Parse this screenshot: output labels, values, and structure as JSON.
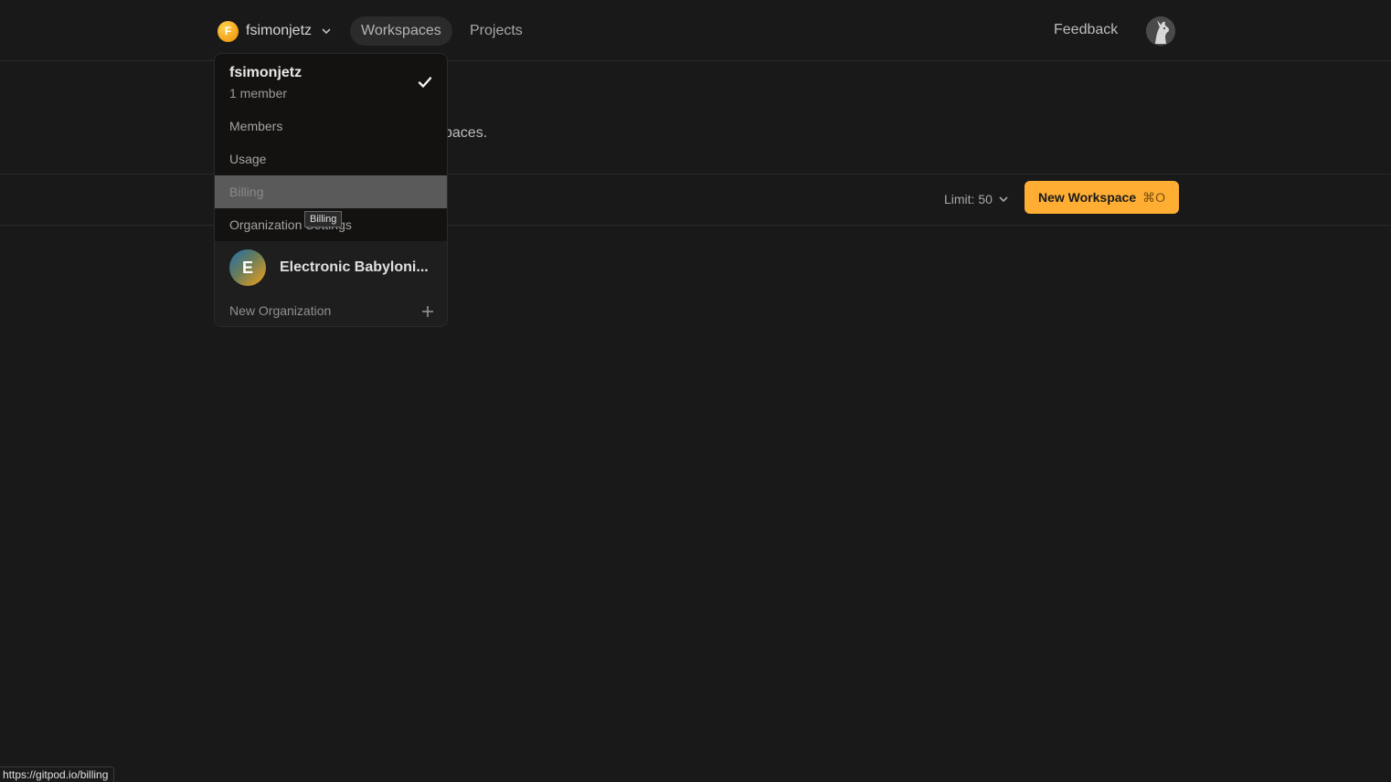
{
  "nav": {
    "org_initial": "F",
    "org_name": "fsimonjetz",
    "tabs": [
      {
        "label": "Workspaces",
        "active": true
      },
      {
        "label": "Projects",
        "active": false
      }
    ],
    "feedback": "Feedback"
  },
  "header": {
    "subtitle_fragment": "paces."
  },
  "toolbar": {
    "limit_label": "Limit: 50",
    "new_workspace_label": "New Workspace",
    "new_workspace_shortcut": "⌘O"
  },
  "dropdown": {
    "current_org": {
      "name": "fsimonjetz",
      "members": "1 member"
    },
    "items": [
      {
        "label": "Members"
      },
      {
        "label": "Usage"
      },
      {
        "label": "Billing",
        "hovered": true
      },
      {
        "label": "Organization Settings"
      }
    ],
    "other_org": {
      "initial": "E",
      "name": "Electronic Babyloni..."
    },
    "new_org_label": "New Organization"
  },
  "tooltip": "Billing",
  "status_url": "https://gitpod.io/billing",
  "colors": {
    "background": "#191919",
    "accent": "#ffae33",
    "hover_item": "#5a5a5a"
  }
}
